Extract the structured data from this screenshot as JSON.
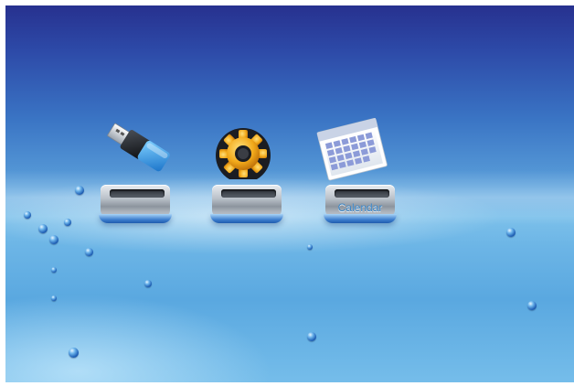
{
  "desktop": {
    "icons": [
      {
        "name": "usb",
        "label": ""
      },
      {
        "name": "settings",
        "label": ""
      },
      {
        "name": "calendar",
        "label": "Calendar"
      }
    ]
  },
  "colors": {
    "bg_top": "#27318f",
    "bg_mid": "#5a9fda",
    "bg_bottom": "#75bdea",
    "pedestal_base": "#3e7fcf",
    "gear": "#f2a91a"
  },
  "icon_names": [
    "usb-drive-icon",
    "gear-icon",
    "calendar-icon"
  ]
}
